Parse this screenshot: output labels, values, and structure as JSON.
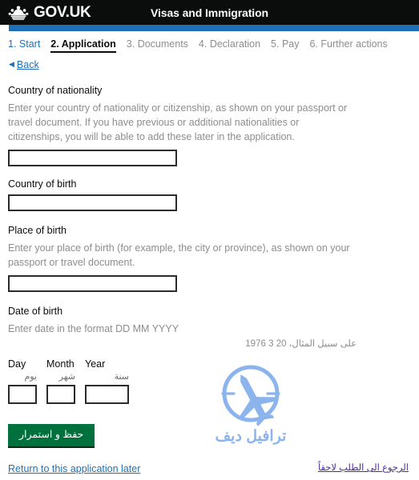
{
  "header": {
    "brand": "GOV.UK",
    "crown_icon": "crown-icon",
    "service_title": "Visas and Immigration",
    "accent_color": "#1d70b8",
    "background_color": "#0b0c0c"
  },
  "steps": [
    {
      "label": "1. Start",
      "state": "link"
    },
    {
      "label": "2. Application",
      "state": "active"
    },
    {
      "label": "3. Documents",
      "state": "muted"
    },
    {
      "label": "4. Declaration",
      "state": "muted"
    },
    {
      "label": "5. Pay",
      "state": "muted"
    },
    {
      "label": "6. Further actions",
      "state": "muted"
    }
  ],
  "back": {
    "arrow": "◀",
    "label": "Back"
  },
  "fields": {
    "nationality": {
      "label": "Country of nationality",
      "hint": "Enter your country of nationality or citizenship, as shown on your passport or travel document. If you have previous or additional nationalities or citizenships, you will be able to add these later in the application.",
      "value": ""
    },
    "country_of_birth": {
      "label": "Country of birth",
      "value": ""
    },
    "place_of_birth": {
      "label": "Place of birth",
      "hint": "Enter your place of birth (for example, the city or province), as shown on your passport or travel document.",
      "value": ""
    },
    "date_of_birth": {
      "label": "Date of birth",
      "hint": "Enter date in the format DD MM YYYY",
      "example_ar": "على سبيل المثال، 20 3 1976",
      "day": {
        "label_en": "Day",
        "label_ar": "يوم",
        "value": ""
      },
      "month": {
        "label_en": "Month",
        "label_ar": "شهر",
        "value": ""
      },
      "year": {
        "label_en": "Year",
        "label_ar": "سنة",
        "value": ""
      }
    }
  },
  "actions": {
    "save_label": "حفظ و استمرار",
    "save_color": "#00703c",
    "return_link": "Return to this application later",
    "return_link_ar": "الرجوع الى الطلب لاحقاً",
    "visited_link_color": "#4c2c92"
  },
  "watermark": {
    "text": "ترافيل ديف",
    "icon": "airplane-in-circle-icon",
    "color": "#8cb4ec"
  }
}
